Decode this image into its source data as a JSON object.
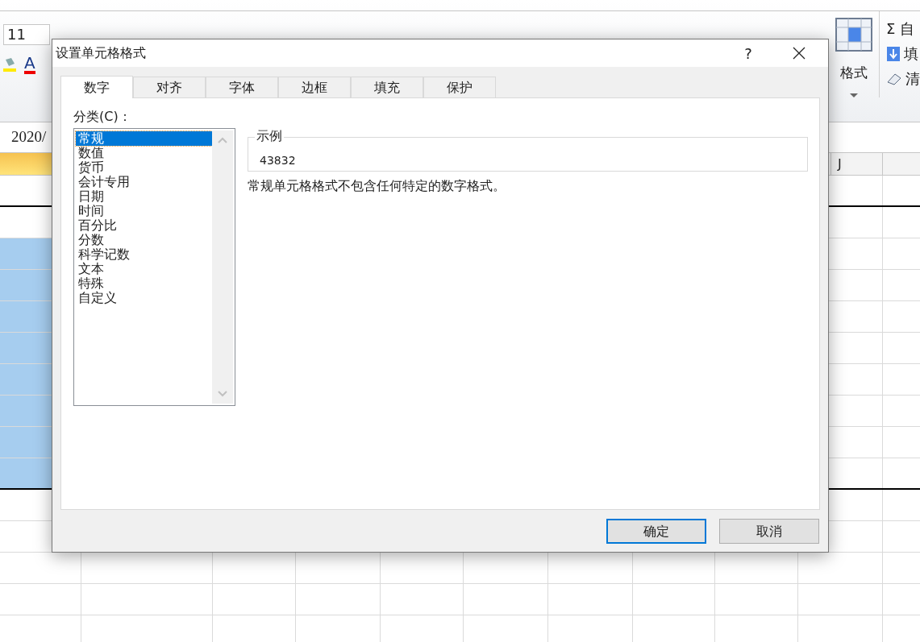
{
  "ribbon": {
    "font_size": "11",
    "font_color_glyph": "A",
    "format_button": "格式",
    "editing_items": [
      "Σ 自",
      "填",
      "清"
    ]
  },
  "formula_bar": {
    "value": "2020/"
  },
  "column_header": {
    "label": "J"
  },
  "dialog": {
    "title": "设置单元格格式",
    "help": "?",
    "tabs": [
      {
        "label": "数字",
        "selected": true
      },
      {
        "label": "对齐",
        "selected": false
      },
      {
        "label": "字体",
        "selected": false
      },
      {
        "label": "边框",
        "selected": false
      },
      {
        "label": "填充",
        "selected": false
      },
      {
        "label": "保护",
        "selected": false
      }
    ],
    "category_label": "分类(C)：",
    "categories": [
      {
        "label": "常规",
        "selected": true
      },
      {
        "label": "数值",
        "selected": false
      },
      {
        "label": "货币",
        "selected": false
      },
      {
        "label": "会计专用",
        "selected": false
      },
      {
        "label": "日期",
        "selected": false
      },
      {
        "label": "时间",
        "selected": false
      },
      {
        "label": "百分比",
        "selected": false
      },
      {
        "label": "分数",
        "selected": false
      },
      {
        "label": "科学记数",
        "selected": false
      },
      {
        "label": "文本",
        "selected": false
      },
      {
        "label": "特殊",
        "selected": false
      },
      {
        "label": "自定义",
        "selected": false
      }
    ],
    "sample": {
      "legend": "示例",
      "value": "43832"
    },
    "description": "常规单元格格式不包含任何特定的数字格式。",
    "buttons": [
      {
        "label": "确定",
        "default": true
      },
      {
        "label": "取消",
        "default": false
      }
    ]
  }
}
